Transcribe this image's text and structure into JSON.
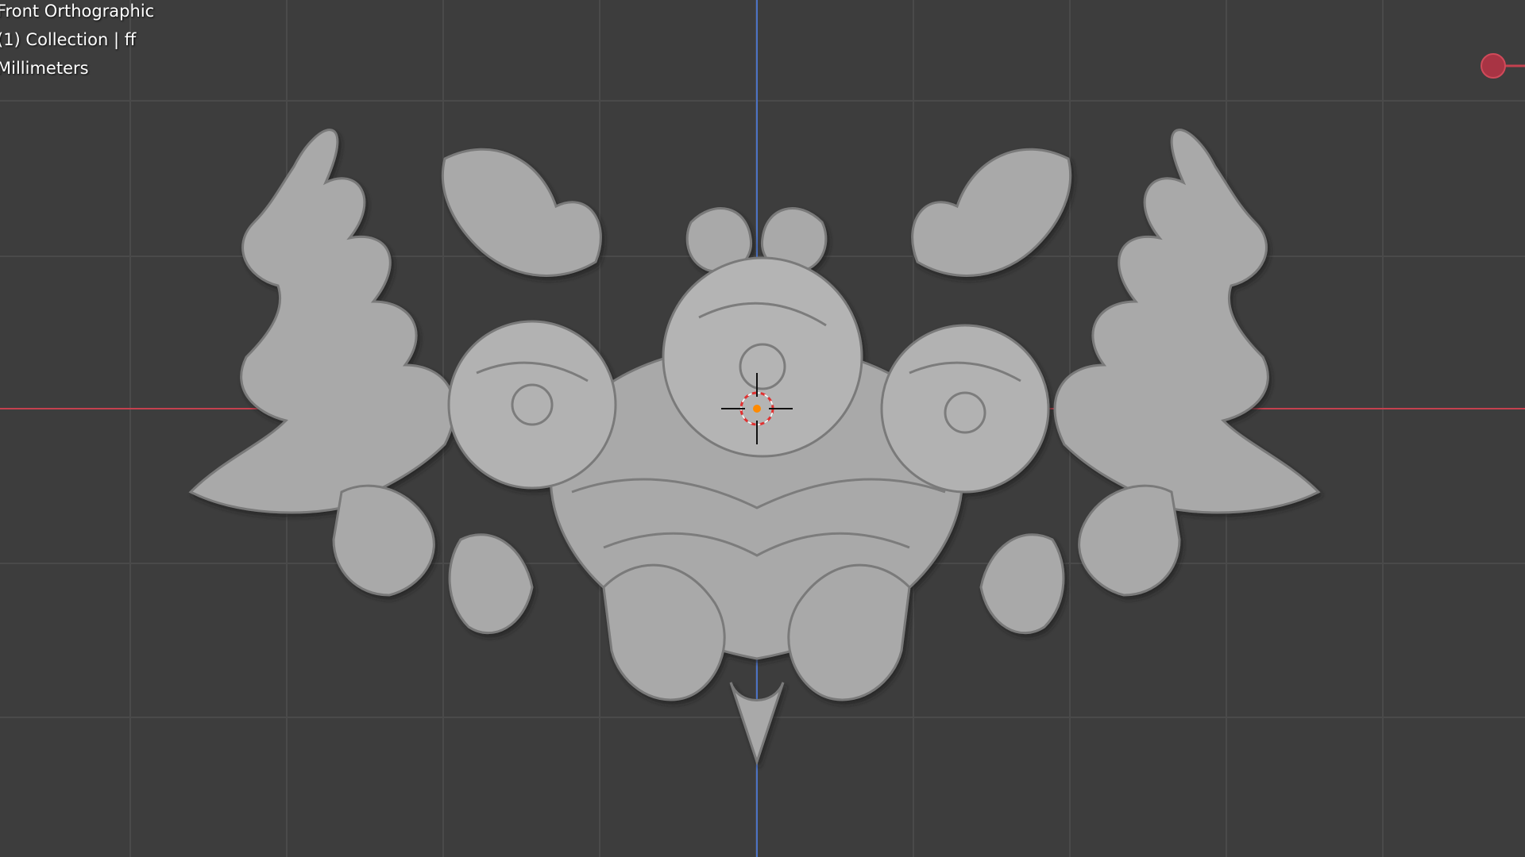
{
  "viewport": {
    "view_name": "Front Orthographic",
    "collection_label": "(1) Collection | ff",
    "units_label": "Millimeters"
  },
  "colors": {
    "background": "#3d3d3d",
    "grid_line": "#4a4a4a",
    "x_axis": "#c4414f",
    "z_axis": "#4c72c4",
    "model": "#a9a9a9",
    "model_shadow": "#6f6f6f",
    "model_highlight": "#c8c8c8",
    "origin_dot": "#ff8a00",
    "cursor_ring": "#e03030"
  },
  "icons": {
    "cursor": "3d-cursor-icon",
    "gizmo": "x-axis-gizmo-icon"
  }
}
